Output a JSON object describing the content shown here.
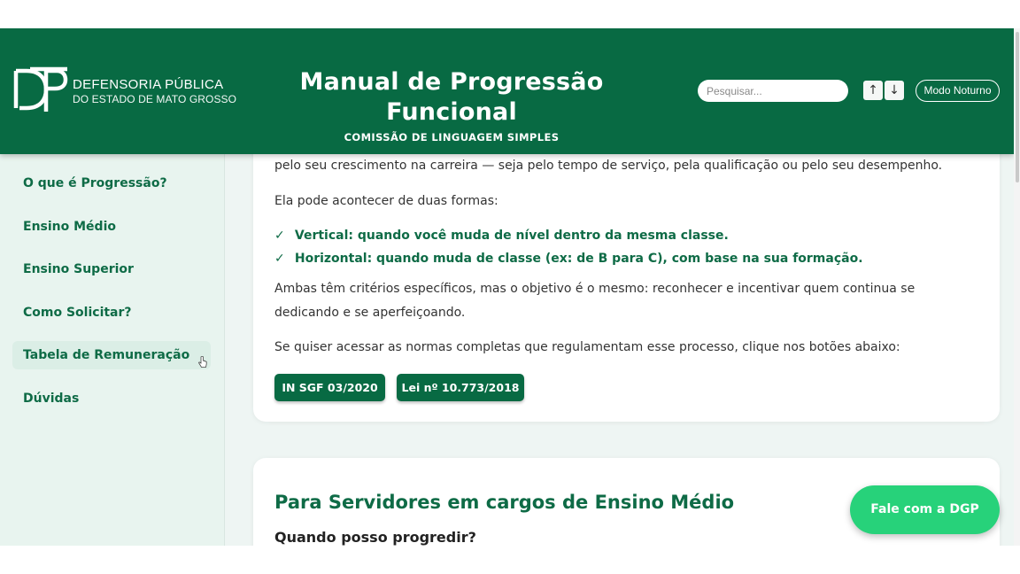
{
  "header": {
    "logo": {
      "line1": "DEFENSORIA PÚBLICA",
      "line2": "DO ESTADO DE MATO GROSSO"
    },
    "title": "Manual de Progressão Funcional",
    "subtitle": "COMISSÃO DE LINGUAGEM SIMPLES",
    "search": {
      "placeholder": "Pesquisar...",
      "value": ""
    },
    "up_label": "↑",
    "down_label": "↓",
    "night_mode_label": "Modo Noturno"
  },
  "sidebar": {
    "items": [
      {
        "label": "O que é Progressão?"
      },
      {
        "label": "Ensino Médio"
      },
      {
        "label": "Ensino Superior"
      },
      {
        "label": "Como Solicitar?"
      },
      {
        "label": "Tabela de Remuneração"
      },
      {
        "label": "Dúvidas"
      }
    ]
  },
  "content": {
    "intro_tail": "pelo seu crescimento na carreira — seja pelo tempo de serviço, pela qualificação ou pelo seu desempenho.",
    "forms_intro": "Ela pode acontecer de duas formas:",
    "checks": [
      {
        "text": "Vertical: quando você muda de nível dentro da mesma classe."
      },
      {
        "text": "Horizontal: quando muda de classe (ex: de B para C), com base na sua formação."
      }
    ],
    "check_glyph": "✓",
    "both": "Ambas têm critérios específicos, mas o objetivo é o mesmo: reconhecer e incentivar quem continua se dedicando e se aperfeiçoando.",
    "norms": "Se quiser acessar as normas completas que regulamentam esse processo, clique nos botões abaixo:",
    "buttons": [
      {
        "label": "IN SGF 03/2020"
      },
      {
        "label": "Lei nº 10.773/2018"
      }
    ],
    "section2_title": "Para Servidores em cargos de Ensino Médio",
    "section2_sub": "Quando posso progredir?"
  },
  "fab": {
    "label": "Fale com a DGP"
  },
  "colors": {
    "primary": "#086a43",
    "accent": "#27d27a",
    "sidebar_bg": "#e8f4ef",
    "text_green": "#0e6b46"
  },
  "icons": {
    "cursor": "hand-cursor-icon",
    "logo": "dp-logo-icon"
  }
}
